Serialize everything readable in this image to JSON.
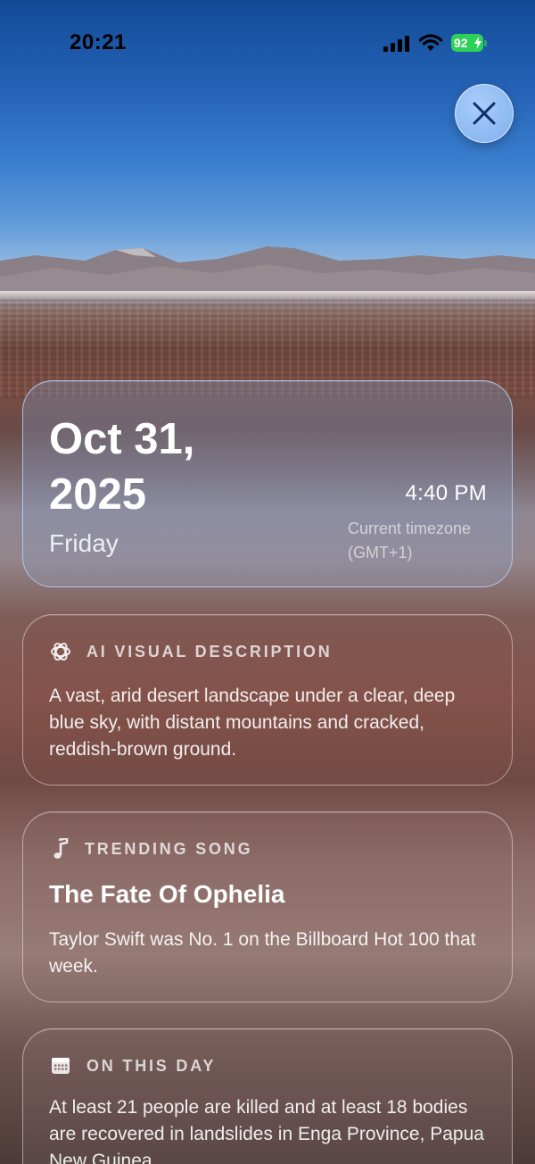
{
  "status_bar": {
    "time": "20:21",
    "battery": "92"
  },
  "icons": {
    "close": "close-icon",
    "ai": "sparkle-flower-icon",
    "song": "music-note-icon",
    "day": "calendar-icon"
  },
  "date_card": {
    "date_line1": "Oct 31,",
    "date_line2": "2025",
    "weekday": "Friday",
    "time": "4:40 PM",
    "timezone_label": "Current timezone",
    "timezone_value": "(GMT+1)"
  },
  "ai_card": {
    "title": "AI VISUAL DESCRIPTION",
    "text": "A vast, arid desert landscape under a clear, deep blue sky, with distant mountains and cracked, reddish-brown ground."
  },
  "song_card": {
    "title": "TRENDING SONG",
    "song": "The Fate Of Ophelia",
    "text": "Taylor Swift was No. 1 on the Billboard Hot 100 that week."
  },
  "day_card": {
    "title": "ON THIS DAY",
    "text": "At least 21 people are killed and at least 18 bodies are recovered in landslides in Enga Province, Papua New Guinea."
  },
  "colors": {
    "battery": "#2ed158",
    "close_button": "#8fbcf3"
  }
}
